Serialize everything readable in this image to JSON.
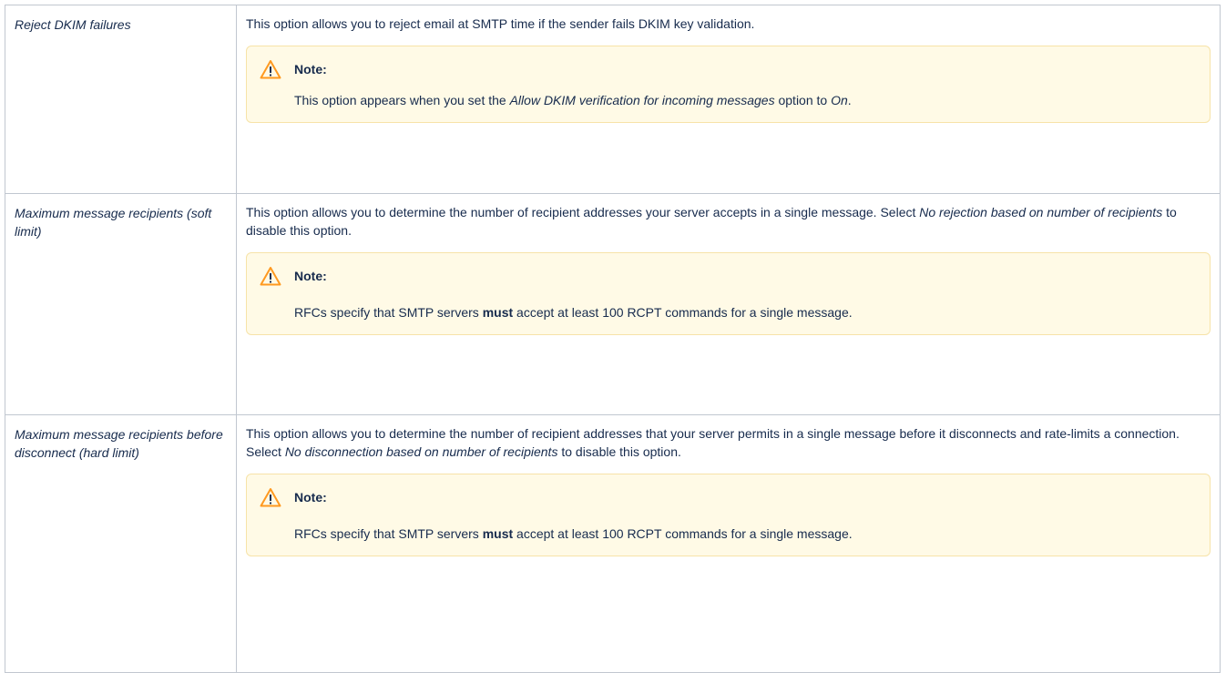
{
  "rows": [
    {
      "name": "Reject DKIM failures",
      "description": "This option allows you to reject email at SMTP time if the sender fails DKIM key validation.",
      "note": {
        "title": "Note:",
        "pre": "This option appears when you set the ",
        "em1": "Allow DKIM verification for incoming messages",
        "mid": " option to ",
        "em2": "On",
        "post": "."
      }
    },
    {
      "name": "Maximum message recipients (soft limit)",
      "desc_pre": "This option allows you to determine the number of recipient addresses your server accepts in a single message. Select ",
      "desc_em": "No rejection based on number of recipients",
      "desc_post": " to disable this option.",
      "note": {
        "title": "Note:",
        "pre": "RFCs specify that SMTP servers ",
        "strong": "must",
        "post": " accept at least 100 RCPT commands for a single message."
      }
    },
    {
      "name": "Maximum message recipients before disconnect (hard limit)",
      "desc_pre": "This option allows you to determine the number of recipient addresses that your server permits in a single message before it disconnects and rate-limits a connection. Select ",
      "desc_em": "No disconnection based on number of recipients",
      "desc_post": " to disable this option.",
      "note": {
        "title": "Note:",
        "pre": "RFCs specify that SMTP servers ",
        "strong": "must",
        "post": " accept at least 100 RCPT commands for a single message."
      }
    }
  ],
  "icons": {
    "warning": "warning-icon"
  },
  "colors": {
    "note_background": "#fffae6",
    "note_border": "#f7e3a8",
    "warning_icon": "#ff991f",
    "table_border": "#c1c7d0",
    "text": "#172b4d"
  }
}
